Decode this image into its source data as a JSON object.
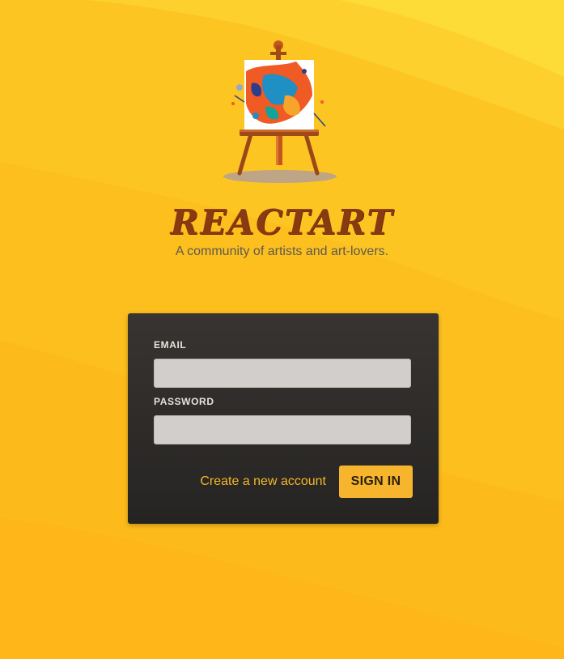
{
  "brand": {
    "title": "REACTART",
    "subtitle": "A community of artists and art-lovers."
  },
  "logo": {
    "icon": "easel-painting-logo"
  },
  "login_form": {
    "email_label": "EMAIL",
    "email_value": "",
    "password_label": "PASSWORD",
    "password_value": "",
    "create_account_label": "Create a new account",
    "sign_in_label": "SIGN IN"
  },
  "colors": {
    "background": "#fcc21f",
    "brand_title": "#8a3a10",
    "card": "#2f2c2a",
    "accent": "#f6b52c",
    "input": "#d1cecb"
  }
}
